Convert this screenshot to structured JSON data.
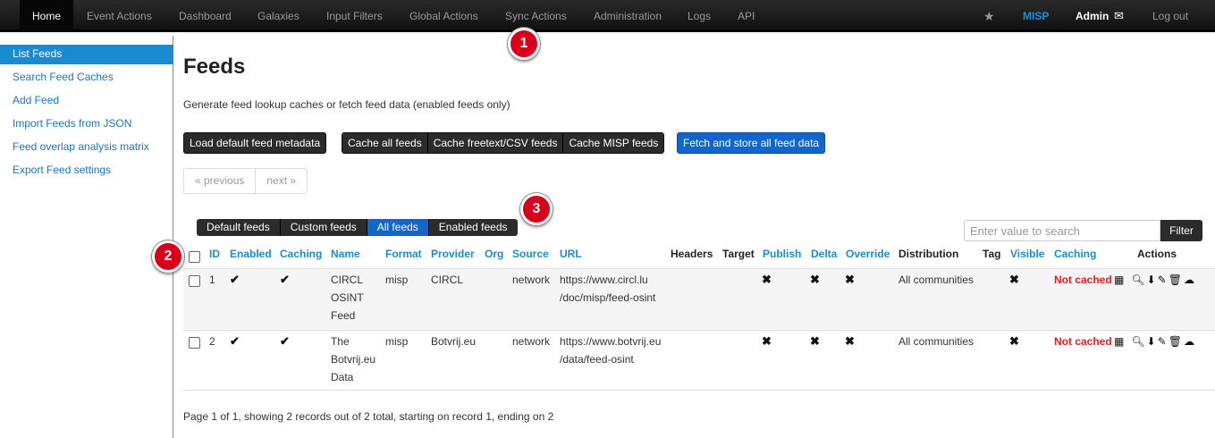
{
  "navbar": {
    "items": [
      "Home",
      "Event Actions",
      "Dashboard",
      "Galaxies",
      "Input Filters",
      "Global Actions",
      "Sync Actions",
      "Administration",
      "Logs",
      "API"
    ],
    "star_icon": "star-icon",
    "brand": "MISP",
    "user": "Admin",
    "mail_icon": "envelope-icon",
    "logout": "Log out"
  },
  "sidebar": {
    "items": [
      "List Feeds",
      "Search Feed Caches",
      "Add Feed",
      "Import Feeds from JSON",
      "Feed overlap analysis matrix",
      "Export Feed settings"
    ]
  },
  "main": {
    "title": "Feeds",
    "description": "Generate feed lookup caches or fetch feed data (enabled feeds only)",
    "buttons": {
      "load_default": "Load default feed metadata",
      "cache_all": "Cache all feeds",
      "cache_freetext": "Cache freetext/CSV feeds",
      "cache_misp": "Cache MISP feeds",
      "fetch_store": "Fetch and store all feed data"
    },
    "pager": {
      "previous": "« previous",
      "next": "next »"
    },
    "filter_tabs": [
      "Default feeds",
      "Custom feeds",
      "All feeds",
      "Enabled feeds"
    ],
    "active_filter": "All feeds",
    "search_placeholder": "Enter value to search",
    "filter_button": "Filter",
    "footer": "Page 1 of 1, showing 2 records out of 2 total, starting on record 1, ending on 2"
  },
  "table": {
    "headers": {
      "id": "ID",
      "enabled": "Enabled",
      "caching": "Caching",
      "name": "Name",
      "format": "Format",
      "provider": "Provider",
      "org": "Org",
      "source": "Source",
      "url": "URL",
      "headers": "Headers",
      "target": "Target",
      "publish": "Publish",
      "delta": "Delta",
      "override": "Override",
      "distribution": "Distribution",
      "tag": "Tag",
      "visible": "Visible",
      "caching2": "Caching",
      "actions": "Actions"
    },
    "rows": [
      {
        "id": "1",
        "enabled": "✔",
        "caching": "✔",
        "name": [
          "CIRCL",
          "OSINT",
          "Feed"
        ],
        "format": "misp",
        "provider": "CIRCL",
        "source": "network",
        "url": [
          "https://www.circl.lu",
          "/doc/misp/feed-osint"
        ],
        "publish": "✖",
        "delta": "✖",
        "override": "✖",
        "distribution": "All communities",
        "visible": "✖",
        "cache_status": "Not cached"
      },
      {
        "id": "2",
        "enabled": "✔",
        "caching": "✔",
        "name": [
          "The",
          "Botvrij.eu",
          "Data"
        ],
        "format": "misp",
        "provider": "Botvrij.eu",
        "source": "network",
        "url": [
          "https://www.botvrij.eu",
          "/data/feed-osint"
        ],
        "publish": "✖",
        "delta": "✖",
        "override": "✖",
        "distribution": "All communities",
        "visible": "✖",
        "cache_status": "Not cached"
      }
    ]
  },
  "callouts": [
    "1",
    "2",
    "3"
  ],
  "colors": {
    "accent": "#1a8bd1",
    "primary_button": "#1166cc",
    "danger": "#e02020",
    "badge": "#d9001b"
  }
}
